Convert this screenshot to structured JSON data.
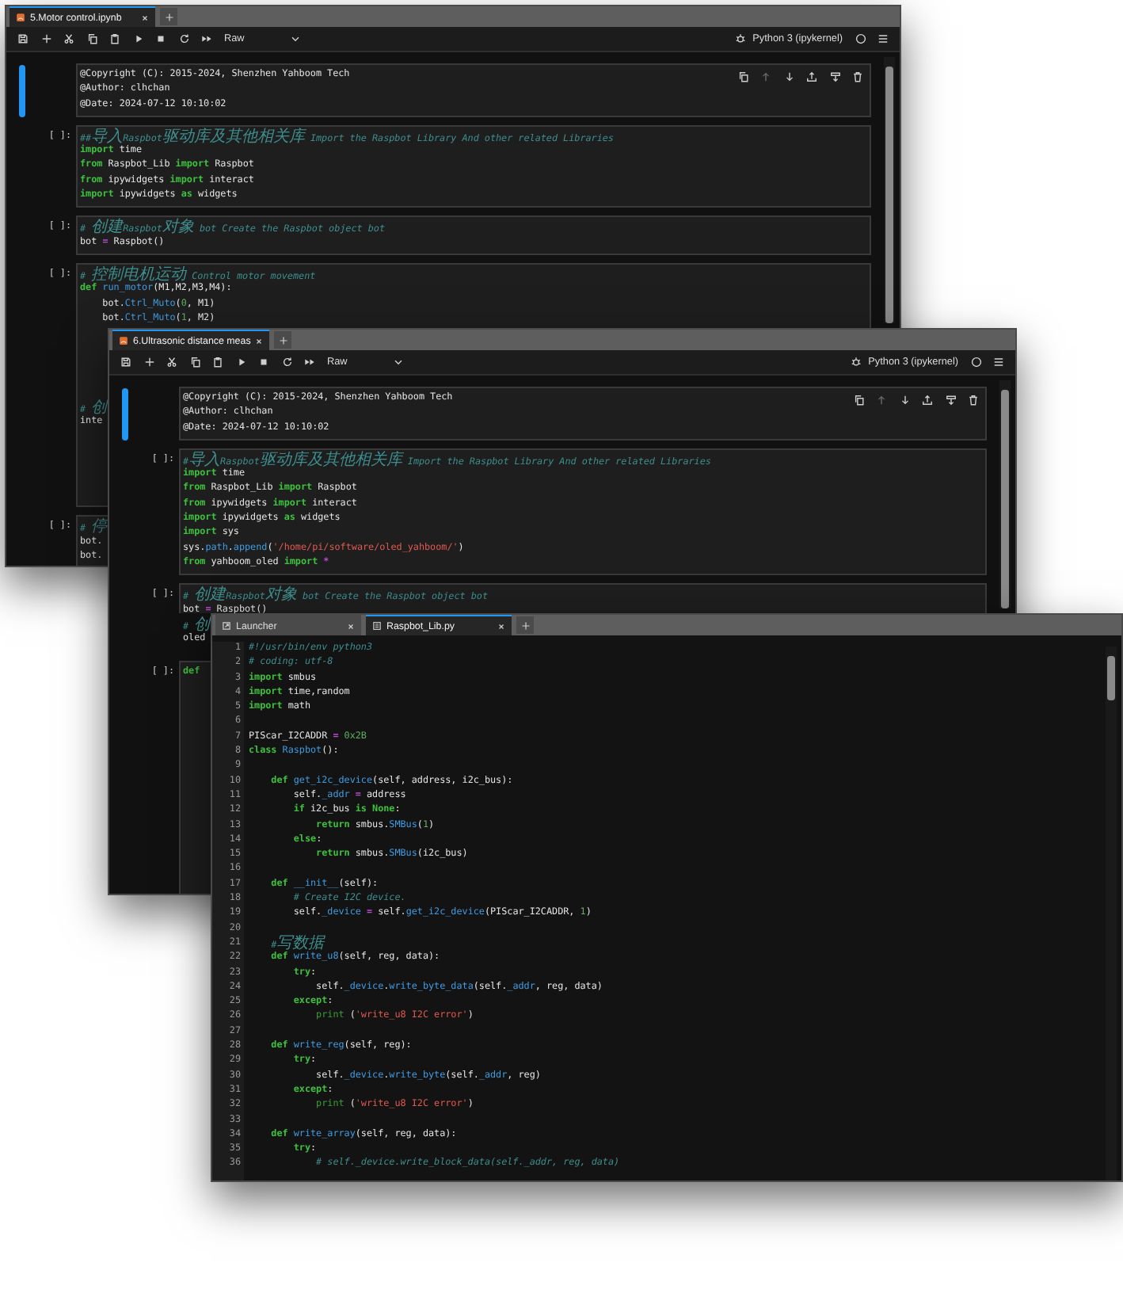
{
  "windows": [
    {
      "kind": "notebook",
      "tabs": [
        {
          "kind": "notebook",
          "label": "5.Motor control.ipynb",
          "selected": true
        }
      ],
      "toolbar": {
        "cell_type": "Raw",
        "kernel": "Python 3 (ipykernel)"
      },
      "cells": [
        {
          "active": true,
          "lines": [
            [
              "@Copyright (C): 2015-2024, Shenzhen Yahboom Tech"
            ],
            [
              "@Author: clhchan"
            ],
            [
              "@Date: 2024-07-12 10:10:02"
            ]
          ]
        },
        {
          "prompt": "[ ]:",
          "active": false,
          "lines": [
            [
              {
                "kind": "comment",
                "text": "##导入Raspbot驱动库及其他相关库 Import the Raspbot Library And other related Libraries"
              }
            ],
            [
              {
                "kind": "keyword",
                "text": "import"
              },
              " time"
            ],
            [
              {
                "kind": "keyword",
                "text": "from"
              },
              " Raspbot_Lib ",
              {
                "kind": "keyword",
                "text": "import"
              },
              " Raspbot"
            ],
            [
              {
                "kind": "keyword",
                "text": "from"
              },
              " ipywidgets ",
              {
                "kind": "keyword",
                "text": "import"
              },
              " interact"
            ],
            [
              {
                "kind": "keyword",
                "text": "import"
              },
              " ipywidgets ",
              {
                "kind": "keyword",
                "text": "as"
              },
              " widgets"
            ]
          ]
        },
        {
          "prompt": "[ ]:",
          "active": false,
          "lines": [
            [
              {
                "kind": "comment",
                "text": "# 创建Raspbot对象 bot Create the Raspbot object bot"
              }
            ],
            [
              "bot ",
              {
                "kind": "operator",
                "text": "="
              },
              " Raspbot()"
            ]
          ]
        },
        {
          "prompt": "[ ]:",
          "active": false,
          "lines": [
            [
              {
                "kind": "comment",
                "text": "# 控制电机运动 Control motor movement"
              }
            ],
            [
              {
                "kind": "keyword",
                "text": "def"
              },
              {
                "kind": "name",
                "text": " run_motor"
              },
              "(M1,M2,M3,M4):"
            ],
            [
              "    bot.",
              {
                "kind": "name",
                "text": "Ctrl_Muto"
              },
              "(",
              {
                "kind": "number",
                "text": "0"
              },
              ", M1)"
            ],
            [
              "    bot.",
              {
                "kind": "name",
                "text": "Ctrl_Muto"
              },
              "(",
              {
                "kind": "number",
                "text": "1"
              },
              ", M2)"
            ],
            [
              {
                "kind": "comment",
                "text": "# 创"
              }
            ],
            [
              "inte"
            ]
          ]
        },
        {
          "prompt": "[ ]:",
          "active": false,
          "lines": [
            [
              {
                "kind": "comment",
                "text": "# 停"
              }
            ],
            [
              "bot."
            ],
            [
              "bot."
            ]
          ]
        }
      ]
    },
    {
      "kind": "notebook",
      "tabs": [
        {
          "kind": "notebook",
          "label": "6.Ultrasonic distance meas",
          "selected": true
        }
      ],
      "toolbar": {
        "cell_type": "Raw",
        "kernel": "Python 3 (ipykernel)"
      },
      "cells": [
        {
          "active": true,
          "lines": [
            [
              "@Copyright (C): 2015-2024, Shenzhen Yahboom Tech"
            ],
            [
              "@Author: clhchan"
            ],
            [
              "@Date: 2024-07-12 10:10:02"
            ]
          ]
        },
        {
          "prompt": "[ ]:",
          "active": false,
          "lines": [
            [
              {
                "kind": "comment",
                "text": "#导入Raspbot驱动库及其他相关库 Import the Raspbot Library And other related Libraries"
              }
            ],
            [
              {
                "kind": "keyword",
                "text": "import"
              },
              " time"
            ],
            [
              {
                "kind": "keyword",
                "text": "from"
              },
              " Raspbot_Lib ",
              {
                "kind": "keyword",
                "text": "import"
              },
              " Raspbot"
            ],
            [
              {
                "kind": "keyword",
                "text": "from"
              },
              " ipywidgets ",
              {
                "kind": "keyword",
                "text": "import"
              },
              " interact"
            ],
            [
              {
                "kind": "keyword",
                "text": "import"
              },
              " ipywidgets ",
              {
                "kind": "keyword",
                "text": "as"
              },
              " widgets"
            ],
            [
              {
                "kind": "keyword",
                "text": "import"
              },
              " sys"
            ],
            [
              "sys.",
              {
                "kind": "name",
                "text": "path"
              },
              ".",
              {
                "kind": "name",
                "text": "append"
              },
              "(",
              {
                "kind": "string",
                "text": "'/home/pi/software/oled_yahboom/'"
              },
              ")"
            ],
            [
              {
                "kind": "keyword",
                "text": "from"
              },
              " yahboom_oled ",
              {
                "kind": "keyword",
                "text": "import"
              },
              {
                "kind": "operator",
                "text": " *"
              }
            ]
          ]
        },
        {
          "prompt": "[ ]:",
          "active": false,
          "lines": [
            [
              {
                "kind": "comment",
                "text": "# 创建Raspbot对象 bot Create the Raspbot object bot"
              }
            ],
            [
              "bot ",
              {
                "kind": "operator",
                "text": "="
              },
              " Raspbot()"
            ],
            [
              {
                "kind": "comment",
                "text": "# 创"
              }
            ],
            [
              "oled"
            ]
          ]
        },
        {
          "prompt": "[ ]:",
          "active": false,
          "lines": [
            [
              {
                "kind": "keyword",
                "text": "def"
              }
            ]
          ]
        }
      ]
    },
    {
      "kind": "editor",
      "tabs": [
        {
          "kind": "launcher",
          "label": "Launcher",
          "selected": false
        },
        {
          "kind": "file",
          "label": "Raspbot_Lib.py",
          "selected": true
        }
      ],
      "lines": [
        {
          "number": "1",
          "code": [
            {
              "kind": "comment",
              "text": "#!/usr/bin/env python3"
            }
          ]
        },
        {
          "number": "2",
          "code": [
            {
              "kind": "comment",
              "text": "# coding: utf-8"
            }
          ]
        },
        {
          "number": "3",
          "code": [
            {
              "kind": "keyword",
              "text": "import"
            },
            " smbus"
          ]
        },
        {
          "number": "4",
          "code": [
            {
              "kind": "keyword",
              "text": "import"
            },
            " time,random"
          ]
        },
        {
          "number": "5",
          "code": [
            {
              "kind": "keyword",
              "text": "import"
            },
            " math"
          ]
        },
        {
          "number": "6"
        },
        {
          "number": "7",
          "code": [
            "PIScar_I2CADDR ",
            {
              "kind": "operator",
              "text": "="
            },
            {
              "kind": "number",
              "text": " 0x2B"
            }
          ]
        },
        {
          "number": "8",
          "code": [
            {
              "kind": "keyword",
              "text": "class"
            },
            {
              "kind": "name",
              "text": " Raspbot"
            },
            "():"
          ]
        },
        {
          "number": "9"
        },
        {
          "number": "10",
          "code": [
            {
              "kind": "keyword",
              "text": "    def"
            },
            {
              "kind": "name",
              "text": " get_i2c_device"
            },
            "(self, address, i2c_bus):"
          ]
        },
        {
          "number": "11",
          "code": [
            "        self.",
            {
              "kind": "name",
              "text": "_addr"
            },
            {
              "kind": "operator",
              "text": " ="
            },
            " address"
          ]
        },
        {
          "number": "12",
          "code": [
            {
              "kind": "keyword",
              "text": "        if"
            },
            " i2c_bus ",
            {
              "kind": "keyword",
              "text": "is"
            },
            {
              "kind": "keyword",
              "text": " None"
            },
            ":"
          ]
        },
        {
          "number": "13",
          "code": [
            {
              "kind": "keyword",
              "text": "            return"
            },
            " smbus.",
            {
              "kind": "name",
              "text": "SMBus"
            },
            "(",
            {
              "kind": "number",
              "text": "1"
            },
            ")"
          ]
        },
        {
          "number": "14",
          "code": [
            {
              "kind": "keyword",
              "text": "        else"
            },
            ":"
          ]
        },
        {
          "number": "15",
          "code": [
            {
              "kind": "keyword",
              "text": "            return"
            },
            " smbus.",
            {
              "kind": "name",
              "text": "SMBus"
            },
            "(i2c_bus)"
          ]
        },
        {
          "number": "16"
        },
        {
          "number": "17",
          "code": [
            {
              "kind": "keyword",
              "text": "    def"
            },
            {
              "kind": "name",
              "text": " __init__"
            },
            "(self):"
          ]
        },
        {
          "number": "18",
          "code": [
            {
              "kind": "comment",
              "text": "        # Create I2C device."
            }
          ]
        },
        {
          "number": "19",
          "code": [
            "        self.",
            {
              "kind": "name",
              "text": "_device"
            },
            {
              "kind": "operator",
              "text": " ="
            },
            " self.",
            {
              "kind": "name",
              "text": "get_i2c_device"
            },
            "(PIScar_I2CADDR, ",
            {
              "kind": "number",
              "text": "1"
            },
            ")"
          ]
        },
        {
          "number": "20"
        },
        {
          "number": "21",
          "code": [
            {
              "kind": "comment",
              "text": "    #写数据"
            }
          ]
        },
        {
          "number": "22",
          "code": [
            {
              "kind": "keyword",
              "text": "    def"
            },
            {
              "kind": "name",
              "text": " write_u8"
            },
            "(self, reg, data):"
          ]
        },
        {
          "number": "23",
          "code": [
            {
              "kind": "keyword",
              "text": "        try"
            },
            ":"
          ]
        },
        {
          "number": "24",
          "code": [
            "            self.",
            {
              "kind": "name",
              "text": "_device"
            },
            ".",
            {
              "kind": "name",
              "text": "write_byte_data"
            },
            "(self.",
            {
              "kind": "name",
              "text": "_addr"
            },
            ", reg, data)"
          ]
        },
        {
          "number": "25",
          "code": [
            {
              "kind": "keyword",
              "text": "        except"
            },
            ":"
          ]
        },
        {
          "number": "26",
          "code": [
            {
              "kind": "builtin",
              "text": "            print"
            },
            " (",
            {
              "kind": "string",
              "text": "'write_u8 I2C error'"
            },
            ")"
          ]
        },
        {
          "number": "27"
        },
        {
          "number": "28",
          "code": [
            {
              "kind": "keyword",
              "text": "    def"
            },
            {
              "kind": "name",
              "text": " write_reg"
            },
            "(self, reg):"
          ]
        },
        {
          "number": "29",
          "code": [
            {
              "kind": "keyword",
              "text": "        try"
            },
            ":"
          ]
        },
        {
          "number": "30",
          "code": [
            "            self.",
            {
              "kind": "name",
              "text": "_device"
            },
            ".",
            {
              "kind": "name",
              "text": "write_byte"
            },
            "(self.",
            {
              "kind": "name",
              "text": "_addr"
            },
            ", reg)"
          ]
        },
        {
          "number": "31",
          "code": [
            {
              "kind": "keyword",
              "text": "        except"
            },
            ":"
          ]
        },
        {
          "number": "32",
          "code": [
            {
              "kind": "builtin",
              "text": "            print"
            },
            " (",
            {
              "kind": "string",
              "text": "'write_u8 I2C error'"
            },
            ")"
          ]
        },
        {
          "number": "33"
        },
        {
          "number": "34",
          "code": [
            {
              "kind": "keyword",
              "text": "    def"
            },
            {
              "kind": "name",
              "text": " write_array"
            },
            "(self, reg, data):"
          ]
        },
        {
          "number": "35",
          "code": [
            {
              "kind": "keyword",
              "text": "        try"
            },
            ":"
          ]
        },
        {
          "number": "36",
          "code": [
            {
              "kind": "comment",
              "text": "            # self._device.write_block_data(self._addr, reg, data)"
            }
          ]
        }
      ]
    }
  ]
}
